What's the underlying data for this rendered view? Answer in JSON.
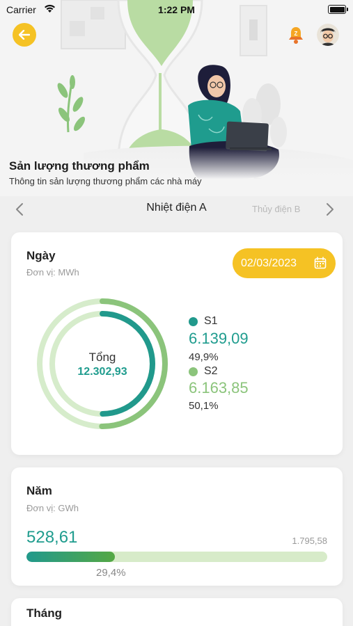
{
  "status_bar": {
    "carrier": "Carrier",
    "time": "1:22 PM"
  },
  "header": {
    "title": "Sản lượng thương phẩm",
    "subtitle": "Thông tin sản lượng thương phẩm các nhà máy",
    "icons": {
      "back": "back-arrow-icon",
      "bell": "bell-icon",
      "avatar": "user-avatar"
    }
  },
  "plant_nav": {
    "current": "Nhiệt điện A",
    "next": "Thủy điện B"
  },
  "day_card": {
    "title": "Ngày",
    "unit": "Đơn vị: MWh",
    "date": "02/03/2023",
    "total_label": "Tổng",
    "total_value": "12.302,93",
    "series": [
      {
        "name": "S1",
        "value": "6.139,09",
        "percent": "49,9%",
        "fraction": 0.499,
        "color": "#21998c"
      },
      {
        "name": "S2",
        "value": "6.163,85",
        "percent": "50,1%",
        "fraction": 0.501,
        "color": "#8bc47b"
      }
    ]
  },
  "year_card": {
    "title": "Năm",
    "unit": "Đơn vị: GWh",
    "value": "528,61",
    "total": "1.795,58",
    "percent": "29,4%",
    "fraction": 0.294
  },
  "month_card": {
    "title": "Tháng"
  },
  "colors": {
    "accent": "#f5c224",
    "teal": "#1f9c8e",
    "green": "#8bc47b",
    "light_green": "#d7ebc9"
  }
}
